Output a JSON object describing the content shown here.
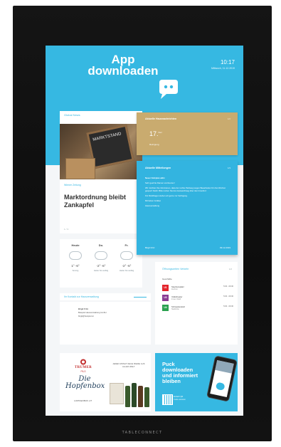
{
  "header": {
    "title_line1": "App",
    "title_line2": "downloaden",
    "time": "10:17",
    "date": "Mittwoch, 11.12.2019"
  },
  "news": {
    "tab_label": "Global News",
    "chalkboard_text": "MARKTSTAND",
    "meta": "Wiener Zeitung",
    "headline": "Marktordnung bleibt Zankapfel",
    "pager": "1/3"
  },
  "weather": {
    "days": [
      {
        "name": "Heute",
        "temp": "1° -6°",
        "cond": "Sonnig"
      },
      {
        "name": "Do.",
        "temp": "-2° -6°",
        "cond": "Heiter bis wolkig"
      },
      {
        "name": "Fr.",
        "temp": "-2° -6°",
        "cond": "Heiter bis wolkig"
      }
    ]
  },
  "shop": {
    "title": "Aktuelle Hausnachrichten",
    "pager": "1/2",
    "temp": "17.",
    "temp_sup": "Dez",
    "subtitle": "Reinigung"
  },
  "notice": {
    "title": "Aktuelle Mitteilungen",
    "pager": "1/3",
    "lines": [
      "Neuer Fahrplan aktiv",
      "Sehr geehrte Damen und Herren!",
      "Wir möchten Sie informieren, dass der rechte Parkweg wegen Bauarbeiten für drei Wochen gesperrt bleibt. Bitte nutzen Sie den Ausweichweg über den Innenhof.",
      "Für Rückfragen stehen wir gerne zur Verfügung.",
      "Mit lieben Grüßen",
      "Hausverwaltung"
    ],
    "footer_left": "Birgit Fritz",
    "footer_right": "09.12.2019"
  },
  "hours": {
    "title": "Öffnungszeiten Verkehr",
    "pager": "1/2",
    "subtitle": "Geschäfte",
    "rows": [
      {
        "badge": "U1",
        "color": "#e3242b",
        "name": "Stephansplatz",
        "desc": "Zentrum",
        "time": "5:00 - 00:30"
      },
      {
        "badge": "U3",
        "color": "#8a3b93",
        "name": "Volkstheater",
        "desc": "Innere Stadt",
        "time": "5:00 - 00:30"
      },
      {
        "badge": "U4",
        "color": "#2aa14f",
        "name": "Schwedenplatz",
        "desc": "Stadtmitte",
        "time": "5:00 - 00:30"
      }
    ]
  },
  "contact": {
    "label": "Ihr Kontakt zur Hausverwaltung",
    "name": "Birgit Fritz",
    "line1": "Beispiel Hausverwaltung GmbH",
    "line2": "birgit@beispiel.at"
  },
  "ad": {
    "brand": "TRUMER",
    "sub": "PILS",
    "script": "Die Hopfenbox",
    "url": "HOPFENBOX.AT",
    "tagline": "JEDEN MONAT NEUE BIERE AUS ALLER WELT"
  },
  "promo": {
    "title_line1": "Puck",
    "title_line2": "downloaden",
    "title_line3": "und informiert",
    "title_line4": "bleiben",
    "qr_text1": "Einfach QR",
    "qr_text2": "Code scannen"
  },
  "frame": {
    "brand": "TABLECONNECT"
  },
  "colors": {
    "accent": "#36b8e2",
    "shop": "#c9ab6f",
    "frame": "#111111"
  }
}
